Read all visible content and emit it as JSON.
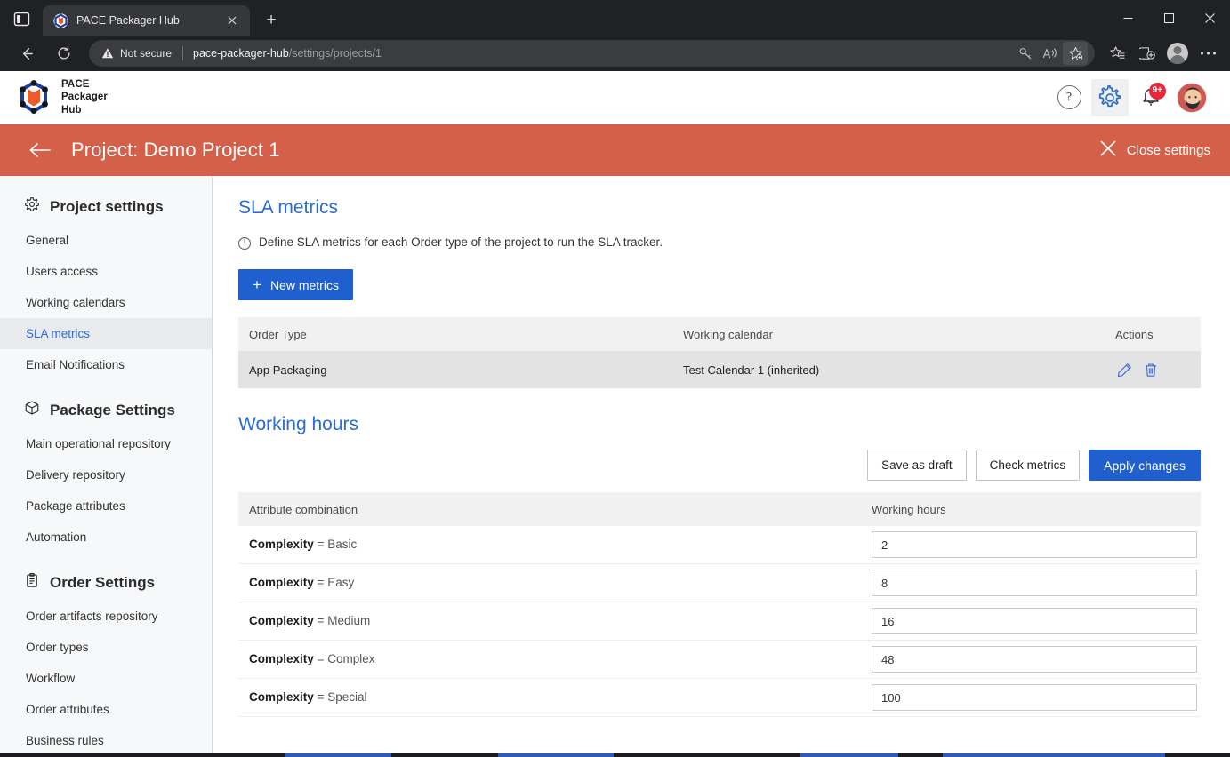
{
  "browser": {
    "tab": {
      "title": "PACE Packager Hub",
      "favicon_icon": "pace-cube-icon",
      "close_icon": "close-icon"
    },
    "new_tab_label": "+",
    "sidebar_toggle_icon": "split-pane-icon",
    "back_icon": "back-arrow-icon",
    "reload_icon": "reload-icon",
    "omnibox": {
      "security_label": "Not secure",
      "security_icon": "warning-triangle-icon",
      "url_host": "pace-packager-hub",
      "url_path": "/settings/projects/1",
      "icons": [
        "key-icon",
        "read-aloud-icon",
        "add-favorite-icon"
      ]
    },
    "toolbar_icons": [
      "favorites-icon",
      "collections-icon",
      "profile-icon",
      "settings-and-more-icon"
    ],
    "window_controls": {
      "minimize": "minimize-icon",
      "maximize": "maximize-icon",
      "close": "close-icon"
    }
  },
  "app": {
    "brand": {
      "line1": "PACE",
      "line2": "Packager",
      "line3": "Hub",
      "logo_icon": "pace-cube-logo-icon"
    },
    "header_actions": {
      "help_label": "?",
      "help_icon": "help-icon",
      "settings_icon": "gear-icon",
      "notifications_icon": "bell-icon",
      "notifications_badge": "9+",
      "avatar_icon": "user-avatar"
    }
  },
  "project_bar": {
    "back_icon": "back-arrow-icon",
    "title": "Project: Demo Project 1",
    "close_label": "Close settings",
    "close_icon": "close-icon",
    "background_color": "#d4604a"
  },
  "sidebar": {
    "groups": [
      {
        "title": "Project settings",
        "icon": "gear-icon",
        "items": [
          {
            "label": "General",
            "selected": false
          },
          {
            "label": "Users access",
            "selected": false
          },
          {
            "label": "Working calendars",
            "selected": false
          },
          {
            "label": "SLA metrics",
            "selected": true
          },
          {
            "label": "Email Notifications",
            "selected": false
          }
        ]
      },
      {
        "title": "Package Settings",
        "icon": "package-icon",
        "items": [
          {
            "label": "Main operational repository",
            "selected": false
          },
          {
            "label": "Delivery repository",
            "selected": false
          },
          {
            "label": "Package attributes",
            "selected": false
          },
          {
            "label": "Automation",
            "selected": false
          }
        ]
      },
      {
        "title": "Order Settings",
        "icon": "clipboard-icon",
        "items": [
          {
            "label": "Order artifacts repository",
            "selected": false
          },
          {
            "label": "Order types",
            "selected": false
          },
          {
            "label": "Workflow",
            "selected": false
          },
          {
            "label": "Order attributes",
            "selected": false
          },
          {
            "label": "Business rules",
            "selected": false
          }
        ]
      }
    ]
  },
  "main": {
    "sla": {
      "title": "SLA metrics",
      "hint": "Define SLA metrics for each Order type of the project to run the SLA tracker.",
      "hint_icon": "info-icon",
      "new_metrics_label": "New metrics",
      "new_metrics_plus": "+",
      "accent_color": "#1f5fce",
      "table": {
        "columns": [
          "Order Type",
          "Working calendar",
          "Actions"
        ],
        "rows": [
          {
            "order_type": "App Packaging",
            "working_calendar": "Test Calendar 1 (inherited)",
            "actions": [
              "edit-icon",
              "delete-icon"
            ]
          }
        ]
      }
    },
    "working_hours": {
      "title": "Working hours",
      "buttons": {
        "save_draft": "Save as draft",
        "check_metrics": "Check metrics",
        "apply_changes": "Apply changes"
      },
      "columns": [
        "Attribute combination",
        "Working hours"
      ],
      "rows": [
        {
          "attribute": "Complexity",
          "operator": "=",
          "value": "Basic",
          "hours": "2"
        },
        {
          "attribute": "Complexity",
          "operator": "=",
          "value": "Easy",
          "hours": "8"
        },
        {
          "attribute": "Complexity",
          "operator": "=",
          "value": "Medium",
          "hours": "16"
        },
        {
          "attribute": "Complexity",
          "operator": "=",
          "value": "Complex",
          "hours": "48"
        },
        {
          "attribute": "Complexity",
          "operator": "=",
          "value": "Special",
          "hours": "100"
        }
      ]
    }
  }
}
